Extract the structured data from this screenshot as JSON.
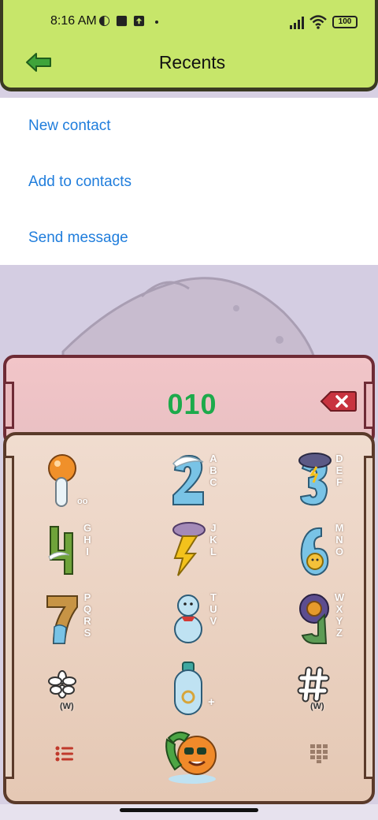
{
  "status_bar": {
    "time": "8:16 AM",
    "battery": "100",
    "icons": [
      "vpn-icon",
      "app-square-icon",
      "upload-icon",
      "signal-icon",
      "wifi-icon",
      "battery-icon"
    ]
  },
  "header": {
    "title": "Recents",
    "back_icon": "back-arrow-icon"
  },
  "menu": {
    "items": [
      {
        "label": "New contact"
      },
      {
        "label": "Add to contacts"
      },
      {
        "label": "Send message"
      }
    ]
  },
  "display": {
    "number": "010",
    "delete_icon": "backspace-icon"
  },
  "keypad": {
    "keys": [
      {
        "digit": "1",
        "letters": "",
        "sub": "oo"
      },
      {
        "digit": "2",
        "letters": "ABC"
      },
      {
        "digit": "3",
        "letters": "DEF"
      },
      {
        "digit": "4",
        "letters": "GHI"
      },
      {
        "digit": "5",
        "letters": "JKL"
      },
      {
        "digit": "6",
        "letters": "MNO"
      },
      {
        "digit": "7",
        "letters": "PQRS"
      },
      {
        "digit": "8",
        "letters": "TUV"
      },
      {
        "digit": "9",
        "letters": "WXYZ"
      },
      {
        "digit": "*",
        "sub": "(W)"
      },
      {
        "digit": "0",
        "sub": "+"
      },
      {
        "digit": "#",
        "sub": "(W)"
      }
    ],
    "bottom_row": {
      "left_icon": "list-icon",
      "center_icon": "call-button-icon",
      "right_icon": "dialpad-grid-icon"
    }
  },
  "colors": {
    "header_bg": "#c7e66a",
    "menu_link": "#1f7ddc",
    "number": "#1daa4b",
    "display_bg": "#f2c5c8",
    "keypad_bg": "#f0dccf"
  }
}
